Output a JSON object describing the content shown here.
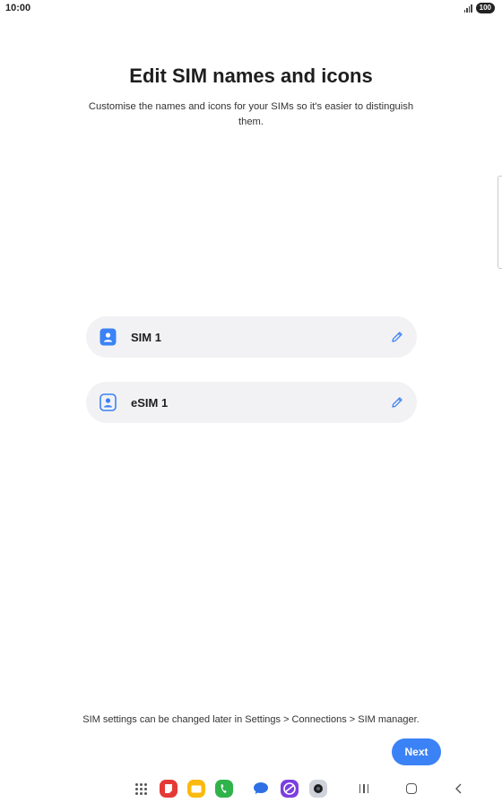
{
  "status_bar": {
    "time": "10:00",
    "battery": "100"
  },
  "page": {
    "title": "Edit SIM names and icons",
    "subtitle": "Customise the names and icons for your SIMs so it's easier to distinguish them."
  },
  "sims": [
    {
      "label": "SIM 1",
      "icon": "sim-person-icon",
      "edit_icon": "pencil-icon"
    },
    {
      "label": "eSIM 1",
      "icon": "esim-person-icon",
      "edit_icon": "pencil-icon"
    }
  ],
  "footer": {
    "note": "SIM settings can be changed later in Settings > Connections > SIM manager.",
    "next_label": "Next"
  },
  "taskbar": {
    "apps": [
      "app-drawer-icon",
      "notes-app-icon",
      "files-app-icon",
      "phone-app-icon",
      "messages-app-icon",
      "internet-app-icon",
      "camera-app-icon"
    ],
    "nav": [
      "recent-apps-icon",
      "home-icon",
      "back-icon"
    ]
  },
  "colors": {
    "accent": "#3b82f6",
    "card_bg": "#f2f2f4"
  }
}
